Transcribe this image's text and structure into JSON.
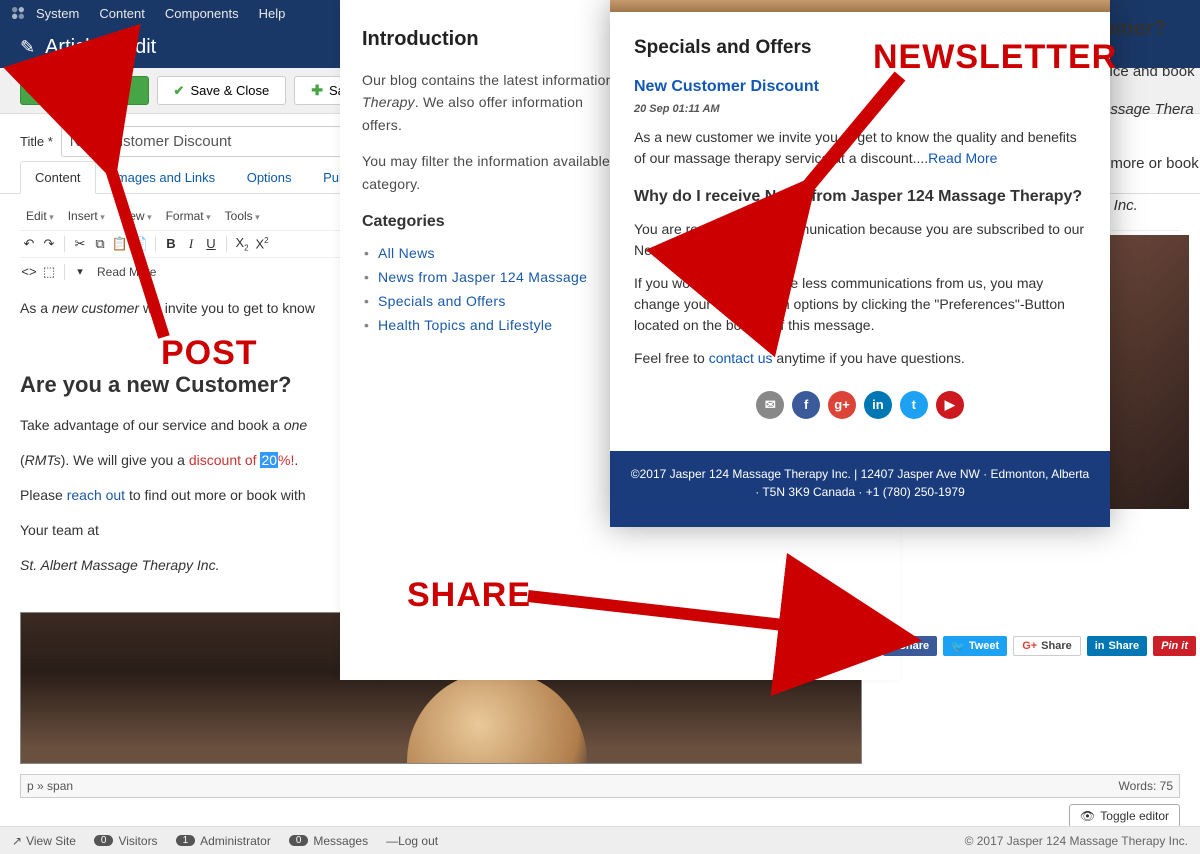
{
  "menubar": {
    "items": [
      "System",
      "Content",
      "Components",
      "Help"
    ]
  },
  "header": {
    "title": "Articles: Edit"
  },
  "buttons": {
    "save": "Save",
    "saveclose": "Save & Close",
    "savenew": "Save & "
  },
  "title": {
    "label": "Title *",
    "value": "New Customer Discount"
  },
  "tabs": [
    "Content",
    "Images and Links",
    "Options",
    "Publishing"
  ],
  "editor": {
    "menus": [
      "Edit",
      "Insert",
      "View",
      "Format",
      "Tools"
    ],
    "readmore": "Read More",
    "body_line1a": "As a ",
    "body_line1b": "new customer",
    "body_line1c": " we invite you to get to know",
    "h2": "Are you a new Customer?",
    "p2a": "Take advantage of our service and book a ",
    "p2b": "one",
    "p3a": "(",
    "p3b": "RMTs",
    "p3c": "). We will give you a ",
    "p3d": "discount of ",
    "p3e": "20",
    "p3f": "%!",
    "p3g": ".",
    "p4a": "Please ",
    "p4b": "reach out",
    "p4c": " to find out more or book with",
    "p5": "Your team at",
    "p6": "St. Albert Massage Therapy Inc.",
    "path": "p » span",
    "words": "Words: 75",
    "toggle": "Toggle editor"
  },
  "blog": {
    "h2": "Introduction",
    "p1": "Our blog contains the latest information",
    "p1b": "Therapy",
    "p1c": ". We also offer information",
    "p1d": "offers.",
    "p2": "You may filter the information available",
    "p2b": "category.",
    "h3": "Categories",
    "cats": [
      "All News",
      "News from Jasper 124 Massage",
      "Specials and Offers",
      "Health Topics and Lifestyle"
    ]
  },
  "news": {
    "h2": "Specials and Offers",
    "post_title": "New Customer Discount",
    "date": "20 Sep 01:11 AM",
    "excerpt_a": "As a new customer we invite you to get to know the quality and benefits of our massage therapy service at a discount....",
    "readmore": "Read More",
    "why_h": "Why do I receive News from Jasper 124 Massage Therapy?",
    "why_p": "You are receiving this communication because you are subscribed to our Newsletter.",
    "pref_p": "If you would like to receive less communications from us, you may change your subscription options by clicking the \"Preferences\"-Button located on the bottom of this message.",
    "contact_a": "Feel free to ",
    "contact_link": "contact us",
    "contact_b": " anytime if you have questions.",
    "footer": "©2017 Jasper 124 Massage Therapy Inc. | 12407 Jasper Ave NW · Edmonton, Alberta · T5N 3K9 Canada · +1 (780) 250-1979"
  },
  "callouts": {
    "post": "POST",
    "newsletter": "NEWSLETTER",
    "share": "SHARE"
  },
  "rightcol": {
    "l1": "omer?",
    "l2": "vice and book",
    "l3": "assage Thera",
    "l4": "t more or book",
    "l5": "y Inc."
  },
  "share": {
    "fb": "Share",
    "tw": "Tweet",
    "gp": "Share",
    "li": "Share",
    "pi": "Pin it"
  },
  "footer": {
    "view": "View Site",
    "visitors_n": "0",
    "visitors": "Visitors",
    "admin_n": "1",
    "admin": "Administrator",
    "msg_n": "0",
    "msg": "Messages",
    "logout": "Log out",
    "copy": "© 2017 Jasper 124 Massage Therapy Inc."
  }
}
